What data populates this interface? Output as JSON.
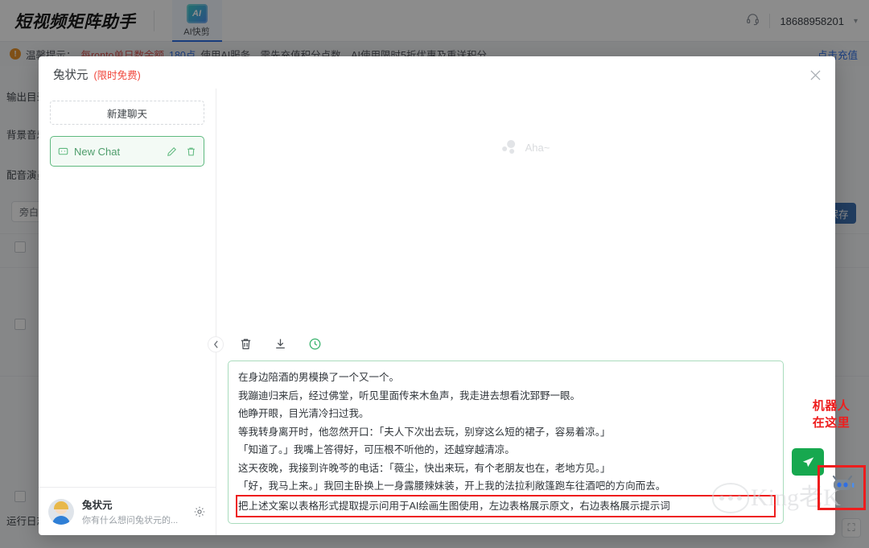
{
  "background": {
    "brand": "短视频矩阵助手",
    "nav_tabs": [
      {
        "label": "AI快剪",
        "icon": "ai-clip-icon",
        "badge": "AI",
        "active": true
      }
    ],
    "header": {
      "support_icon": "headset-icon",
      "phone": "18688958201",
      "caret_icon": "chevron-down-icon"
    },
    "notice": {
      "icon": "warning-icon",
      "prefix": "温馨提示：",
      "emphasis": "每ronto单日数余额",
      "amount": "180点",
      "rest": "使用AI服务、需先充值积分点数，AI使用限时5折优惠及重送积分。",
      "recharge_link": "点击充值"
    },
    "form_labels": [
      "输出目录",
      "背景音乐",
      "配音演员"
    ],
    "pill_label": "旁白文案",
    "blue_button": "保存",
    "bottom_label": "运行日志",
    "checkbox_count": 4
  },
  "modal": {
    "title": "兔状元",
    "title_badge": "(限时免费)",
    "close_icon": "close-icon",
    "sidebar": {
      "new_chat_label": "新建聊天",
      "chat_items": [
        {
          "label": "New Chat",
          "icon": "chat-bubble-icon",
          "edit_icon": "pencil-icon",
          "delete_icon": "trash-icon",
          "active": true
        }
      ],
      "footer": {
        "avatar": "user-avatar",
        "name": "兔状元",
        "subtitle": "你有什么想问兔状元的...",
        "settings_icon": "gear-icon"
      },
      "collapse_icon": "chevron-left-icon"
    },
    "conversation": {
      "placeholder_icon": "loading-dots-icon",
      "placeholder_text": "Aha~"
    },
    "composer": {
      "tools": [
        {
          "name": "clear-icon",
          "glyph": "trash"
        },
        {
          "name": "download-icon",
          "glyph": "download"
        },
        {
          "name": "history-icon",
          "glyph": "clock"
        }
      ],
      "input_lines": [
        "在身边陪酒的男模换了一个又一个。",
        "我蹦迪归来后，经过佛堂，听见里面传来木鱼声，我走进去想看沈郅野一眼。",
        "他睁开眼，目光清冷扫过我。",
        "等我转身离开时，他忽然开口：「夫人下次出去玩，别穿这么短的裙子，容易着凉。」",
        "「知道了。」我嘴上答得好，可压根不听他的，还越穿越清凉。",
        "这天夜晚，我接到许晚芩的电话：「薇尘，快出来玩，有个老朋友也在，老地方见。」",
        "「好，我马上来。」我回主卧换上一身露腰辣妹装，开上我的法拉利敞篷跑车往酒吧的方向而去。"
      ],
      "highlighted_line": "把上述文案以表格形式提取提示问用于AI绘画生图使用，左边表格展示原文，右边表格展示提示词",
      "send_icon": "send-icon"
    }
  },
  "annotation": {
    "text_line1": "机器人",
    "text_line2": "在这里",
    "color": "#ee1d1d",
    "target_icon": "robot-icon"
  },
  "watermark": {
    "text": "King老K",
    "icon": "wechat-bubble-icon"
  }
}
